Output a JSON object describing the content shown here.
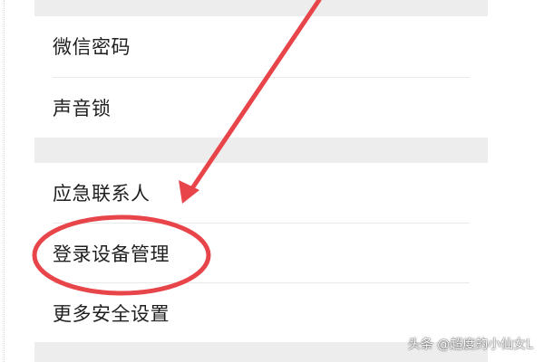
{
  "settings_list": {
    "items": [
      {
        "label": "微信密码"
      },
      {
        "label": "声音锁"
      },
      {
        "label": "应急联系人"
      },
      {
        "label": "登录设备管理"
      },
      {
        "label": "更多安全设置"
      }
    ]
  },
  "annotation": {
    "color": "#e8454b",
    "highlighted_item": "登录设备管理"
  },
  "watermark": {
    "text": "头条 @超度的小仙女L"
  }
}
